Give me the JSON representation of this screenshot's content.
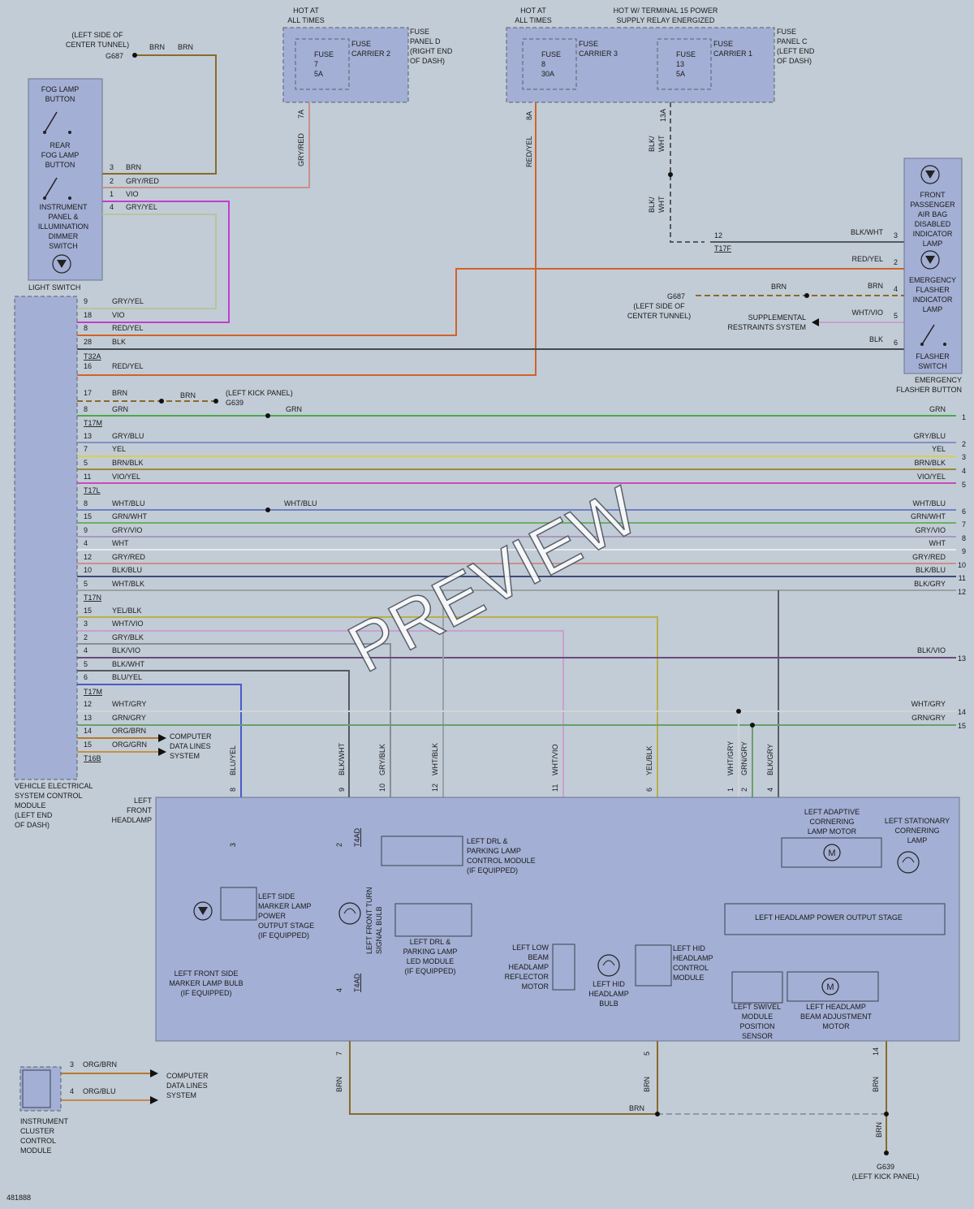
{
  "colors": {
    "background": "#c2ccd6",
    "module_fill": "#a3afd4",
    "wires": {
      "BRN": "#8a6a2a",
      "GRY/RED": "#c9908a",
      "VIO": "#c23ccf",
      "GRY/YEL": "#b8c49a",
      "RED/YEL": "#d2622a",
      "BLK": "#444a52",
      "BLK/WHT": "#555a60",
      "GRN": "#4aa84a",
      "GRY/BLU": "#8090c8",
      "YEL": "#d8d050",
      "BRN/BLK": "#a0883a",
      "VIO/YEL": "#c84cb8",
      "WHT/BLU": "#7080c8",
      "GRN/WHT": "#6ab06a",
      "GRY/VIO": "#a898c0",
      "WHT": "#e8eaec",
      "BLK/BLU": "#3c4a7a",
      "WHT/BLK": "#9aa0a6",
      "YEL/BLK": "#b8b048",
      "WHT/VIO": "#c8a0d0",
      "GRY/BLK": "#8a8e92",
      "BLK/VIO": "#6a4a7a",
      "BLU/YEL": "#4a5ac8",
      "WHT/GRY": "#d0d4d8",
      "GRN/GRY": "#6aa06a",
      "ORG/BRN": "#b8782a",
      "ORG/GRN": "#c89040",
      "ORG/BLU": "#c8884a",
      "BLK/GRY": "#5a5e62"
    }
  },
  "power": {
    "hot_at_all_times": "HOT AT\nALL TIMES",
    "hot_terminal_15": "HOT W/ TERMINAL 15 POWER\nSUPPLY RELAY ENERGIZED",
    "fuse_panel_d": "FUSE\nPANEL D\n(RIGHT END\nOF DASH)",
    "fuse_panel_c": "FUSE\nPANEL C\n(LEFT END\nOF DASH)",
    "fuses": [
      {
        "name": "FUSE\n7\n5A",
        "carrier": "FUSE\nCARRIER 2",
        "pin": "7A",
        "wire": "GRY/RED"
      },
      {
        "name": "FUSE\n8\n30A",
        "carrier": "FUSE\nCARRIER 3",
        "pin": "8A",
        "wire": "RED/YEL"
      },
      {
        "name": "FUSE\n13\n5A",
        "carrier": "FUSE\nCARRIER 1",
        "pin": "13A",
        "wire": "BLK/\nWHT"
      }
    ],
    "blk_wht_2": "BLK/\nWHT"
  },
  "grounds": {
    "g687_top": {
      "label": "G687",
      "location": "(LEFT SIDE OF\nCENTER TUNNEL)",
      "wire1": "BRN",
      "wire2": "BRN"
    },
    "g687_right": {
      "label": "G687",
      "location": "(LEFT SIDE OF\nCENTER TUNNEL)",
      "wire1": "BRN",
      "wire2": "BRN"
    },
    "g639_mid": {
      "label": "G639",
      "location": "(LEFT KICK PANEL)",
      "wire1": "BRN"
    },
    "g639_bottom": {
      "label": "G639",
      "location": "(LEFT KICK PANEL)"
    }
  },
  "light_switch": {
    "title": "LIGHT SWITCH",
    "labels": [
      "FOG LAMP\nBUTTON",
      "REAR\nFOG LAMP\nBUTTON",
      "INSTRUMENT\nPANEL &\nILLUMINATION\nDIMMER\nSWITCH"
    ],
    "pins": [
      {
        "pin": "3",
        "wire": "BRN"
      },
      {
        "pin": "2",
        "wire": "GRY/RED"
      },
      {
        "pin": "1",
        "wire": "VIO"
      },
      {
        "pin": "4",
        "wire": "GRY/YEL"
      }
    ]
  },
  "vesc_module": {
    "title": "VEHICLE ELECTRICAL\nSYSTEM CONTROL\nMODULE\n(LEFT END\nOF DASH)",
    "connectors": [
      "T32A",
      "T17M",
      "T17L",
      "T17N",
      "T17M",
      "T16B"
    ]
  },
  "left_rows": [
    {
      "pin": "9",
      "wire": "GRY/YEL"
    },
    {
      "pin": "18",
      "wire": "VIO"
    },
    {
      "pin": "8",
      "wire": "RED/YEL"
    },
    {
      "pin": "28",
      "wire": "BLK"
    },
    {
      "pin": "16",
      "wire": "RED/YEL"
    },
    {
      "pin": "17",
      "wire": "BRN"
    },
    {
      "pin": "8",
      "wire": "GRN"
    },
    {
      "pin": "13",
      "wire": "GRY/BLU"
    },
    {
      "pin": "7",
      "wire": "YEL"
    },
    {
      "pin": "5",
      "wire": "BRN/BLK"
    },
    {
      "pin": "11",
      "wire": "VIO/YEL"
    },
    {
      "pin": "8",
      "wire": "WHT/BLU"
    },
    {
      "pin": "15",
      "wire": "GRN/WHT"
    },
    {
      "pin": "9",
      "wire": "GRY/VIO"
    },
    {
      "pin": "4",
      "wire": "WHT"
    },
    {
      "pin": "12",
      "wire": "GRY/RED"
    },
    {
      "pin": "10",
      "wire": "BLK/BLU"
    },
    {
      "pin": "5",
      "wire": "WHT/BLK"
    },
    {
      "pin": "15",
      "wire": "YEL/BLK"
    },
    {
      "pin": "3",
      "wire": "WHT/VIO"
    },
    {
      "pin": "2",
      "wire": "GRY/BLK"
    },
    {
      "pin": "4",
      "wire": "BLK/VIO"
    },
    {
      "pin": "5",
      "wire": "BLK/WHT"
    },
    {
      "pin": "6",
      "wire": "BLU/YEL"
    },
    {
      "pin": "12",
      "wire": "WHT/GRY"
    },
    {
      "pin": "13",
      "wire": "GRN/GRY"
    },
    {
      "pin": "14",
      "wire": "ORG/BRN"
    },
    {
      "pin": "15",
      "wire": "ORG/GRN"
    }
  ],
  "mid_labels": {
    "brn_g639": "BRN",
    "grn": "GRN",
    "wht_blu": "WHT/BLU",
    "computer_data": "COMPUTER\nDATA LINES\nSYSTEM"
  },
  "right_rows": [
    {
      "wire": "GRN",
      "ref": "1"
    },
    {
      "wire": "GRY/BLU",
      "ref": "2"
    },
    {
      "wire": "YEL",
      "ref": "3"
    },
    {
      "wire": "BRN/BLK",
      "ref": "4"
    },
    {
      "wire": "VIO/YEL",
      "ref": "5"
    },
    {
      "wire": "WHT/BLU",
      "ref": "6"
    },
    {
      "wire": "GRN/WHT",
      "ref": "7"
    },
    {
      "wire": "GRY/VIO",
      "ref": "8"
    },
    {
      "wire": "WHT",
      "ref": "9"
    },
    {
      "wire": "GRY/RED",
      "ref": "10"
    },
    {
      "wire": "BLK/BLU",
      "ref": "11"
    },
    {
      "wire": "BLK/GRY",
      "ref": "12"
    },
    {
      "wire": "BLK/VIO",
      "ref": "13"
    },
    {
      "wire": "WHT/GRY",
      "ref": "14"
    },
    {
      "wire": "GRN/GRY",
      "ref": "15"
    }
  ],
  "emergency_flasher": {
    "title": "EMERGENCY\nFLASHER BUTTON",
    "labels": [
      "FRONT\nPASSENGER\nAIR BAG\nDISABLED\nINDICATOR\nLAMP",
      "EMERGENCY\nFLASHER\nINDICATOR\nLAMP",
      "FLASHER\nSWITCH"
    ],
    "pins": [
      {
        "pin": "3",
        "wire": "BLK/WHT"
      },
      {
        "pin": "2",
        "wire": "RED/YEL"
      },
      {
        "pin": "4",
        "wire": "BRN"
      },
      {
        "pin": "5",
        "wire": "WHT/VIO"
      },
      {
        "pin": "6",
        "wire": "BLK"
      }
    ],
    "t17f_pin": "12",
    "t17f": "T17F",
    "srs": "SUPPLEMENTAL\nRESTRAINTS SYSTEM"
  },
  "headlamp": {
    "title": "LEFT\nFRONT\nHEADLAMP",
    "top_pins": [
      {
        "pin": "8",
        "wire": "BLU/YEL"
      },
      {
        "pin": "9",
        "wire": "BLK/WHT"
      },
      {
        "pin": "10",
        "wire": "GRY/BLK"
      },
      {
        "pin": "12",
        "wire": "WHT/BLK"
      },
      {
        "pin": "11",
        "wire": "WHT/VIO"
      },
      {
        "pin": "6",
        "wire": "YEL/BLK"
      },
      {
        "pin": "1",
        "wire": "WHT/GRY"
      },
      {
        "pin": "2",
        "wire": "GRN/GRY"
      },
      {
        "pin": "4",
        "wire": "BLK/GRY"
      }
    ],
    "components": {
      "side_marker_stage": "LEFT SIDE\nMARKER LAMP\nPOWER\nOUTPUT STAGE\n(IF EQUIPPED)",
      "side_marker_bulb": "LEFT FRONT SIDE\nMARKER LAMP BULB\n(IF EQUIPPED)",
      "turn_bulb": "LEFT FRONT TURN\nSIGNAL BULB",
      "drl_control": "LEFT DRL &\nPARKING LAMP\nCONTROL MODULE\n(IF EQUIPPED)",
      "drl_led": "LEFT DRL &\nPARKING LAMP\nLED MODULE\n(IF EQUIPPED)",
      "low_beam_motor": "LEFT LOW\nBEAM\nHEADLAMP\nREFLECTOR\nMOTOR",
      "hid_bulb": "LEFT HID\nHEADLAMP\nBULB",
      "hid_control": "LEFT HID\nHEADLAMP\nCONTROL\nMODULE",
      "adaptive_motor": "LEFT ADAPTIVE\nCORNERING\nLAMP MOTOR",
      "stationary_lamp": "LEFT STATIONARY\nCORNERING\nLAMP",
      "power_stage": "LEFT HEADLAMP POWER OUTPUT STAGE",
      "swivel_sensor": "LEFT SWIVEL\nMODULE\nPOSITION\nSENSOR",
      "beam_adjust_motor": "LEFT HEADLAMP\nBEAM ADJUSTMENT\nMOTOR"
    },
    "inner": {
      "pin3": "3",
      "pin2": "2",
      "t4ad": "T4AD",
      "pin4": "4",
      "t4ad_2": "T4AD"
    },
    "bottom_pins": [
      {
        "pin": "7",
        "wire": "BRN"
      },
      {
        "pin": "5",
        "wire": "BRN"
      },
      {
        "pin": "14",
        "wire": "BRN"
      }
    ],
    "ground_brn": "BRN",
    "ground_brn_v": "BRN"
  },
  "instrument_cluster": {
    "title": "INSTRUMENT\nCLUSTER\nCONTROL\nMODULE",
    "pins": [
      {
        "pin": "3",
        "wire": "ORG/BRN"
      },
      {
        "pin": "4",
        "wire": "ORG/BLU"
      }
    ],
    "data_lines": "COMPUTER\nDATA LINES\nSYSTEM"
  },
  "footer_id": "481888",
  "watermark": "PREVIEW"
}
